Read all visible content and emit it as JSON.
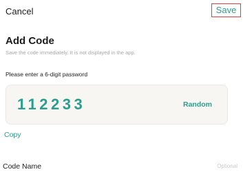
{
  "nav": {
    "cancel_label": "Cancel",
    "save_label": "Save"
  },
  "header": {
    "title": "Add Code",
    "subtitle": "Save the code immediately. It is not displayed in the app."
  },
  "password": {
    "label": "Please enter a 6-digit password",
    "value": "112233",
    "random_label": "Random",
    "copy_label": "Copy"
  },
  "code_name": {
    "label": "Code Name",
    "placeholder": "Optional",
    "value": ""
  },
  "colors": {
    "accent": "#2a9d8f",
    "highlight_border": "#e23b3b",
    "card_background": "#f7f6f3",
    "muted_text": "#a8a8ad"
  }
}
